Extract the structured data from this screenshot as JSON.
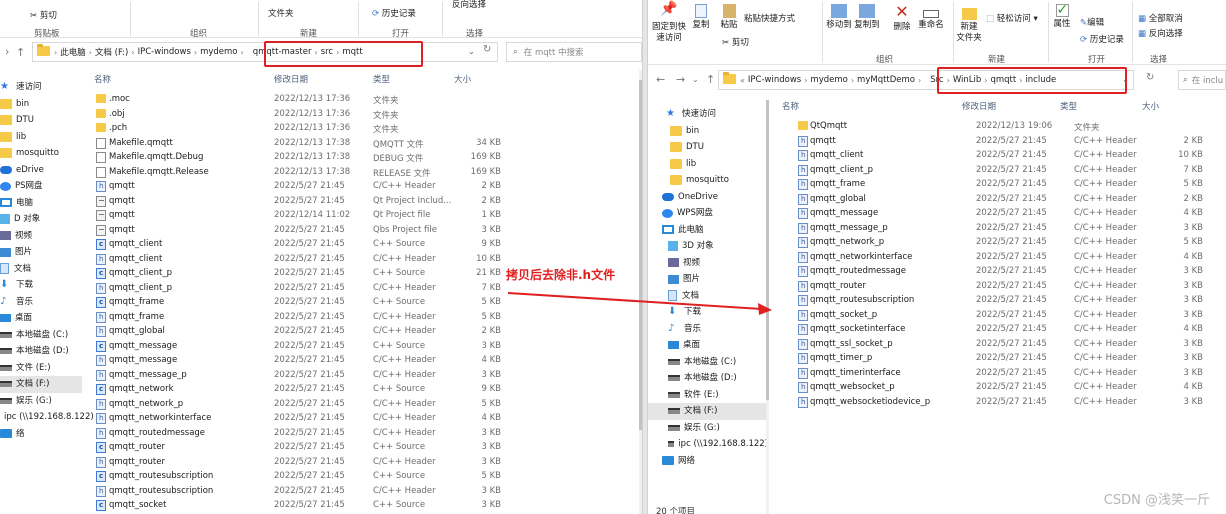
{
  "left": {
    "ribbon": {
      "cut": "剪切",
      "clipboard_group": "剪贴板",
      "organize_group": "组织",
      "new_folder": "文件夹",
      "new_group": "新建",
      "history": "历史记录",
      "open_group": "打开",
      "invert_select": "反向选择",
      "select_group": "选择"
    },
    "address": {
      "crumbs": [
        "此电脑",
        "文档 (F:)",
        "IPC-windows",
        "mydemo",
        "qmqtt-master",
        "src",
        "mqtt"
      ],
      "search_placeholder": "在 mqtt 中搜索"
    },
    "sidebar": [
      {
        "label": "速访问",
        "icon": "star-icon"
      },
      {
        "label": "bin",
        "icon": "folder-icon"
      },
      {
        "label": "DTU",
        "icon": "folder-icon"
      },
      {
        "label": "lib",
        "icon": "folder-icon"
      },
      {
        "label": "mosquitto",
        "icon": "folder-icon"
      },
      {
        "label": "eDrive",
        "icon": "cloud-icon"
      },
      {
        "label": "PS网盘",
        "icon": "wps-icon"
      },
      {
        "label": "电脑",
        "icon": "computer-icon"
      },
      {
        "label": "D 对象",
        "icon": "3d-objects-icon"
      },
      {
        "label": "视频",
        "icon": "video-icon"
      },
      {
        "label": "图片",
        "icon": "pictures-icon"
      },
      {
        "label": "文档",
        "icon": "documents-icon"
      },
      {
        "label": "下载",
        "icon": "download-icon"
      },
      {
        "label": "音乐",
        "icon": "music-icon"
      },
      {
        "label": "桌面",
        "icon": "desktop-icon"
      },
      {
        "label": "本地磁盘 (C:)",
        "icon": "drive-icon"
      },
      {
        "label": "本地磁盘 (D:)",
        "icon": "drive-icon"
      },
      {
        "label": "文件 (E:)",
        "icon": "drive-icon"
      },
      {
        "label": "文档 (F:)",
        "icon": "drive-icon",
        "selected": true
      },
      {
        "label": "娱乐 (G:)",
        "icon": "drive-icon"
      },
      {
        "label": "ipc (\\\\192.168.8.122)",
        "icon": "network-drive-icon"
      },
      {
        "label": "络",
        "icon": "network-icon"
      }
    ],
    "columns": {
      "name": "名称",
      "date": "修改日期",
      "type": "类型",
      "size": "大小"
    },
    "files": [
      {
        "name": ".moc",
        "date": "2022/12/13 17:36",
        "type": "文件夹",
        "size": "",
        "kind": "folder"
      },
      {
        "name": ".obj",
        "date": "2022/12/13 17:36",
        "type": "文件夹",
        "size": "",
        "kind": "folder"
      },
      {
        "name": ".pch",
        "date": "2022/12/13 17:36",
        "type": "文件夹",
        "size": "",
        "kind": "folder"
      },
      {
        "name": "Makefile.qmqtt",
        "date": "2022/12/13 17:38",
        "type": "QMQTT 文件",
        "size": "34 KB",
        "kind": "file"
      },
      {
        "name": "Makefile.qmqtt.Debug",
        "date": "2022/12/13 17:38",
        "type": "DEBUG 文件",
        "size": "169 KB",
        "kind": "file"
      },
      {
        "name": "Makefile.qmqtt.Release",
        "date": "2022/12/13 17:38",
        "type": "RELEASE 文件",
        "size": "169 KB",
        "kind": "file"
      },
      {
        "name": "qmqtt",
        "date": "2022/5/27 21:45",
        "type": "C/C++ Header",
        "size": "2 KB",
        "kind": "header"
      },
      {
        "name": "qmqtt",
        "date": "2022/5/27 21:45",
        "type": "Qt Project Includ...",
        "size": "2 KB",
        "kind": "pro"
      },
      {
        "name": "qmqtt",
        "date": "2022/12/14 11:02",
        "type": "Qt Project file",
        "size": "1 KB",
        "kind": "pro"
      },
      {
        "name": "qmqtt",
        "date": "2022/5/27 21:45",
        "type": "Qbs Project file",
        "size": "3 KB",
        "kind": "pro"
      },
      {
        "name": "qmqtt_client",
        "date": "2022/5/27 21:45",
        "type": "C++ Source",
        "size": "9 KB",
        "kind": "cpp"
      },
      {
        "name": "qmqtt_client",
        "date": "2022/5/27 21:45",
        "type": "C/C++ Header",
        "size": "10 KB",
        "kind": "header"
      },
      {
        "name": "qmqtt_client_p",
        "date": "2022/5/27 21:45",
        "type": "C++ Source",
        "size": "21 KB",
        "kind": "cpp"
      },
      {
        "name": "qmqtt_client_p",
        "date": "2022/5/27 21:45",
        "type": "C/C++ Header",
        "size": "7 KB",
        "kind": "header"
      },
      {
        "name": "qmqtt_frame",
        "date": "2022/5/27 21:45",
        "type": "C++ Source",
        "size": "5 KB",
        "kind": "cpp"
      },
      {
        "name": "qmqtt_frame",
        "date": "2022/5/27 21:45",
        "type": "C/C++ Header",
        "size": "5 KB",
        "kind": "header"
      },
      {
        "name": "qmqtt_global",
        "date": "2022/5/27 21:45",
        "type": "C/C++ Header",
        "size": "2 KB",
        "kind": "header"
      },
      {
        "name": "qmqtt_message",
        "date": "2022/5/27 21:45",
        "type": "C++ Source",
        "size": "3 KB",
        "kind": "cpp"
      },
      {
        "name": "qmqtt_message",
        "date": "2022/5/27 21:45",
        "type": "C/C++ Header",
        "size": "4 KB",
        "kind": "header"
      },
      {
        "name": "qmqtt_message_p",
        "date": "2022/5/27 21:45",
        "type": "C/C++ Header",
        "size": "3 KB",
        "kind": "header"
      },
      {
        "name": "qmqtt_network",
        "date": "2022/5/27 21:45",
        "type": "C++ Source",
        "size": "9 KB",
        "kind": "cpp"
      },
      {
        "name": "qmqtt_network_p",
        "date": "2022/5/27 21:45",
        "type": "C/C++ Header",
        "size": "5 KB",
        "kind": "header"
      },
      {
        "name": "qmqtt_networkinterface",
        "date": "2022/5/27 21:45",
        "type": "C/C++ Header",
        "size": "4 KB",
        "kind": "header"
      },
      {
        "name": "qmqtt_routedmessage",
        "date": "2022/5/27 21:45",
        "type": "C/C++ Header",
        "size": "3 KB",
        "kind": "header"
      },
      {
        "name": "qmqtt_router",
        "date": "2022/5/27 21:45",
        "type": "C++ Source",
        "size": "3 KB",
        "kind": "cpp"
      },
      {
        "name": "qmqtt_router",
        "date": "2022/5/27 21:45",
        "type": "C/C++ Header",
        "size": "3 KB",
        "kind": "header"
      },
      {
        "name": "qmqtt_routesubscription",
        "date": "2022/5/27 21:45",
        "type": "C++ Source",
        "size": "5 KB",
        "kind": "cpp"
      },
      {
        "name": "qmqtt_routesubscription",
        "date": "2022/5/27 21:45",
        "type": "C/C++ Header",
        "size": "3 KB",
        "kind": "header"
      },
      {
        "name": "qmqtt_socket",
        "date": "2022/5/27 21:45",
        "type": "C++ Source",
        "size": "3 KB",
        "kind": "cpp"
      }
    ]
  },
  "right": {
    "ribbon": {
      "pin": "固定到快速访问",
      "copy": "复制",
      "paste": "粘贴",
      "paste_shortcut": "粘贴快捷方式",
      "cut": "剪切",
      "move_to": "移动到",
      "copy_to": "复制到",
      "delete": "删除",
      "rename": "重命名",
      "organize_group": "组织",
      "new_folder": "新建\n文件夹",
      "easy_access": "轻松访问",
      "new_group": "新建",
      "properties": "属性",
      "edit": "编辑",
      "history": "历史记录",
      "open_group": "打开",
      "select_all": "全部取消",
      "invert_select": "反向选择",
      "select_group": "选择"
    },
    "address": {
      "crumbs": [
        "IPC-windows",
        "mydemo",
        "myMqttDemo",
        "Src",
        "WinLib",
        "qmqtt",
        "include"
      ],
      "search_placeholder": "在 inclu"
    },
    "sidebar": [
      {
        "label": "快速访问",
        "icon": "star-icon"
      },
      {
        "label": "bin",
        "icon": "folder-icon"
      },
      {
        "label": "DTU",
        "icon": "folder-icon"
      },
      {
        "label": "lib",
        "icon": "folder-icon"
      },
      {
        "label": "mosquitto",
        "icon": "folder-icon"
      },
      {
        "label": "OneDrive",
        "icon": "cloud-icon"
      },
      {
        "label": "WPS网盘",
        "icon": "wps-icon"
      },
      {
        "label": "此电脑",
        "icon": "computer-icon"
      },
      {
        "label": "3D 对象",
        "icon": "3d-objects-icon"
      },
      {
        "label": "视频",
        "icon": "video-icon"
      },
      {
        "label": "图片",
        "icon": "pictures-icon"
      },
      {
        "label": "文档",
        "icon": "documents-icon"
      },
      {
        "label": "下载",
        "icon": "download-icon"
      },
      {
        "label": "音乐",
        "icon": "music-icon"
      },
      {
        "label": "桌面",
        "icon": "desktop-icon"
      },
      {
        "label": "本地磁盘 (C:)",
        "icon": "drive-icon"
      },
      {
        "label": "本地磁盘 (D:)",
        "icon": "drive-icon"
      },
      {
        "label": "软件 (E:)",
        "icon": "drive-icon"
      },
      {
        "label": "文档 (F:)",
        "icon": "drive-icon",
        "selected": true
      },
      {
        "label": "娱乐 (G:)",
        "icon": "drive-icon"
      },
      {
        "label": "ipc (\\\\192.168.8.122)",
        "icon": "network-drive-icon"
      },
      {
        "label": "网络",
        "icon": "network-icon"
      }
    ],
    "status_text": "20 个项目",
    "columns": {
      "name": "名称",
      "date": "修改日期",
      "type": "类型",
      "size": "大小"
    },
    "files": [
      {
        "name": "QtQmqtt",
        "date": "2022/12/13 19:06",
        "type": "文件夹",
        "size": "",
        "kind": "folder"
      },
      {
        "name": "qmqtt",
        "date": "2022/5/27 21:45",
        "type": "C/C++ Header",
        "size": "2 KB",
        "kind": "header"
      },
      {
        "name": "qmqtt_client",
        "date": "2022/5/27 21:45",
        "type": "C/C++ Header",
        "size": "10 KB",
        "kind": "header"
      },
      {
        "name": "qmqtt_client_p",
        "date": "2022/5/27 21:45",
        "type": "C/C++ Header",
        "size": "7 KB",
        "kind": "header"
      },
      {
        "name": "qmqtt_frame",
        "date": "2022/5/27 21:45",
        "type": "C/C++ Header",
        "size": "5 KB",
        "kind": "header"
      },
      {
        "name": "qmqtt_global",
        "date": "2022/5/27 21:45",
        "type": "C/C++ Header",
        "size": "2 KB",
        "kind": "header"
      },
      {
        "name": "qmqtt_message",
        "date": "2022/5/27 21:45",
        "type": "C/C++ Header",
        "size": "4 KB",
        "kind": "header"
      },
      {
        "name": "qmqtt_message_p",
        "date": "2022/5/27 21:45",
        "type": "C/C++ Header",
        "size": "3 KB",
        "kind": "header"
      },
      {
        "name": "qmqtt_network_p",
        "date": "2022/5/27 21:45",
        "type": "C/C++ Header",
        "size": "5 KB",
        "kind": "header"
      },
      {
        "name": "qmqtt_networkinterface",
        "date": "2022/5/27 21:45",
        "type": "C/C++ Header",
        "size": "4 KB",
        "kind": "header"
      },
      {
        "name": "qmqtt_routedmessage",
        "date": "2022/5/27 21:45",
        "type": "C/C++ Header",
        "size": "3 KB",
        "kind": "header"
      },
      {
        "name": "qmqtt_router",
        "date": "2022/5/27 21:45",
        "type": "C/C++ Header",
        "size": "3 KB",
        "kind": "header"
      },
      {
        "name": "qmqtt_routesubscription",
        "date": "2022/5/27 21:45",
        "type": "C/C++ Header",
        "size": "3 KB",
        "kind": "header"
      },
      {
        "name": "qmqtt_socket_p",
        "date": "2022/5/27 21:45",
        "type": "C/C++ Header",
        "size": "3 KB",
        "kind": "header"
      },
      {
        "name": "qmqtt_socketinterface",
        "date": "2022/5/27 21:45",
        "type": "C/C++ Header",
        "size": "4 KB",
        "kind": "header"
      },
      {
        "name": "qmqtt_ssl_socket_p",
        "date": "2022/5/27 21:45",
        "type": "C/C++ Header",
        "size": "3 KB",
        "kind": "header"
      },
      {
        "name": "qmqtt_timer_p",
        "date": "2022/5/27 21:45",
        "type": "C/C++ Header",
        "size": "3 KB",
        "kind": "header"
      },
      {
        "name": "qmqtt_timerinterface",
        "date": "2022/5/27 21:45",
        "type": "C/C++ Header",
        "size": "3 KB",
        "kind": "header"
      },
      {
        "name": "qmqtt_websocket_p",
        "date": "2022/5/27 21:45",
        "type": "C/C++ Header",
        "size": "4 KB",
        "kind": "header"
      },
      {
        "name": "qmqtt_websocketiodevice_p",
        "date": "2022/5/27 21:45",
        "type": "C/C++ Header",
        "size": "3 KB",
        "kind": "header"
      }
    ]
  },
  "annotation": {
    "text": "拷贝后去除非.h文件",
    "color": "#e02020"
  },
  "watermark": "CSDN @浅笑一斤",
  "colors": {
    "highlight": "#e02020",
    "folder": "#f7c948",
    "selection": "#e5e5e5"
  }
}
